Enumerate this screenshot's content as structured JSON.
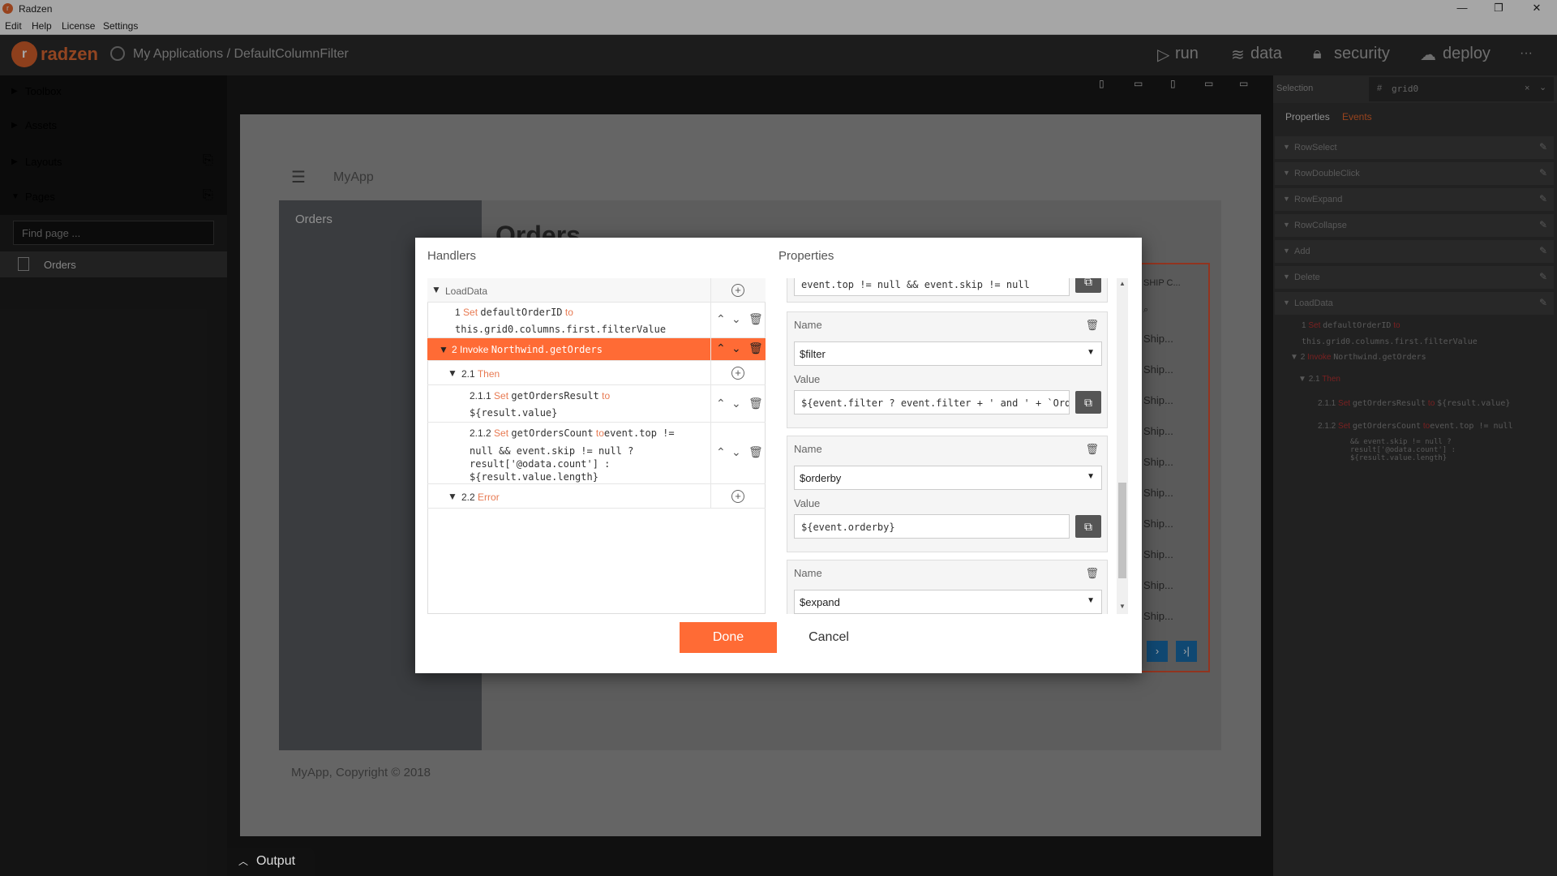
{
  "window": {
    "title": "Radzen"
  },
  "menubar": [
    "Edit",
    "Help",
    "License",
    "Settings"
  ],
  "appbar": {
    "brand": "radzen",
    "breadcrumb": "My Applications / DefaultColumnFilter",
    "nav": [
      {
        "label": "run"
      },
      {
        "label": "data"
      },
      {
        "label": "security"
      },
      {
        "label": "deploy"
      }
    ],
    "more": "···"
  },
  "sidebar": {
    "toolbox": "Toolbox",
    "assets": "Assets",
    "layouts": "Layouts",
    "pages": "Pages",
    "find_placeholder": "Find page ...",
    "page_items": [
      "Orders"
    ]
  },
  "canvas": {
    "app_title": "MyApp",
    "side_item": "Orders",
    "page_heading": "Orders",
    "footer": "MyApp, Copyright © 2018",
    "grid_header": "SHIP C...",
    "grid_cell": "Ship...",
    "grid_rows": 10
  },
  "selection": {
    "label": "Selection",
    "value": "grid0",
    "clear": "×"
  },
  "panel_tabs": {
    "properties": "Properties",
    "events": "Events"
  },
  "events": [
    "RowSelect",
    "RowDoubleClick",
    "RowExpand",
    "RowCollapse",
    "Add",
    "Delete",
    "LoadData"
  ],
  "preview": {
    "l1": {
      "num": "1",
      "kw": "Set",
      "code": "defaultOrderID",
      "to": "to",
      "code2": "this.grid0.columns.first.filterValue"
    },
    "l2": {
      "num": "2",
      "kw": "Invoke",
      "code": "Northwind.getOrders"
    },
    "l3": {
      "num": "2.1",
      "kw": "Then"
    },
    "l4": {
      "num": "2.1.1",
      "kw": "Set",
      "code": "getOrdersResult",
      "to": "to",
      "code2": "${result.value}"
    },
    "l5": {
      "num": "2.1.2",
      "kw": "Set",
      "code": "getOrdersCount",
      "to": "to",
      "code2": "event.top != null",
      "code3": "&& event.skip != null ?",
      "code4": "result['@odata.count'] :",
      "code5": "${result.value.length}"
    }
  },
  "dialog": {
    "handlers_title": "Handlers",
    "properties_title": "Properties",
    "handler_root": "LoadData",
    "h1": {
      "num": "1",
      "kw": "Set",
      "name": "defaultOrderID",
      "to": "to",
      "expr": "this.grid0.columns.first.filterValue"
    },
    "h2": {
      "num": "2",
      "kw": "Invoke",
      "name": "Northwind.getOrders"
    },
    "h21": {
      "num": "2.1",
      "kw": "Then"
    },
    "h211": {
      "num": "2.1.1",
      "kw": "Set",
      "name": "getOrdersResult",
      "to": "to",
      "expr": "${result.value}"
    },
    "h212": {
      "num": "2.1.2",
      "kw": "Set",
      "name": "getOrdersCount",
      "to": "to",
      "expr1": "event.top !=",
      "expr2": "null && event.skip != null ?",
      "expr3": "result['@odata.count'] :",
      "expr4": "${result.value.length}"
    },
    "h22": {
      "num": "2.2",
      "kw": "Error"
    },
    "clipped_value": "event.top != null && event.skip != null",
    "param_name_label": "Name",
    "param_value_label": "Value",
    "params": [
      {
        "name": "$filter",
        "value": "${event.filter ? event.filter + ' and ' + `OrderID eq ${defaultOrderID}` : `OrderID eq ${defaultOrderID}`}"
      },
      {
        "name": "$orderby",
        "value": "${event.orderby}"
      },
      {
        "name": "$expand",
        "value": ""
      }
    ],
    "done": "Done",
    "cancel": "Cancel"
  },
  "output": "Output"
}
